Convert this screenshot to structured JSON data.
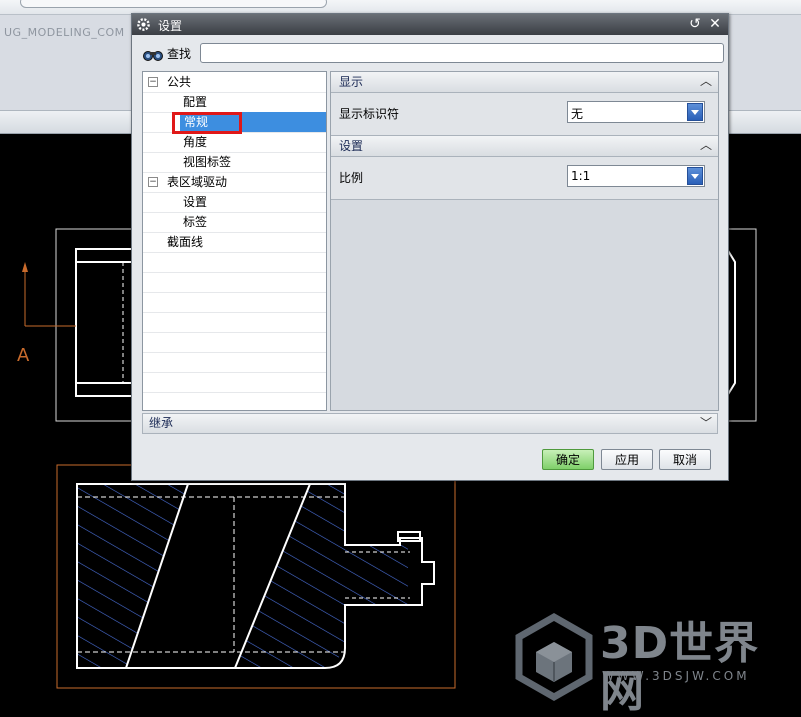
{
  "background": {
    "part_label": "UG_MODELING_COM",
    "view_label": "A",
    "accent_color": "#c96b2c"
  },
  "watermark": {
    "title": "3D世界网",
    "url": "WWW.3DSJW.COM"
  },
  "dialog": {
    "title": "设置",
    "icons": {
      "title": "gear-icon",
      "reset": "reset-icon",
      "close": "close-icon"
    },
    "search": {
      "label": "查找",
      "value": "",
      "placeholder": ""
    },
    "tree": [
      {
        "label": "公共",
        "expander": "⊟"
      },
      {
        "label": "配置"
      },
      {
        "label": "常规",
        "selected": true
      },
      {
        "label": "角度"
      },
      {
        "label": "视图标签"
      },
      {
        "label": "表区域驱动",
        "expander": "⊟"
      },
      {
        "label": "设置"
      },
      {
        "label": "标签"
      },
      {
        "label": "截面线"
      }
    ],
    "sections": {
      "display": {
        "header": "显示",
        "field_label": "显示标识符",
        "field_value": "无"
      },
      "settings": {
        "header": "设置",
        "field_label": "比例",
        "field_value": "1:1"
      }
    },
    "inherit": {
      "label": "继承"
    },
    "buttons": {
      "ok": "确定",
      "apply": "应用",
      "cancel": "取消"
    }
  }
}
